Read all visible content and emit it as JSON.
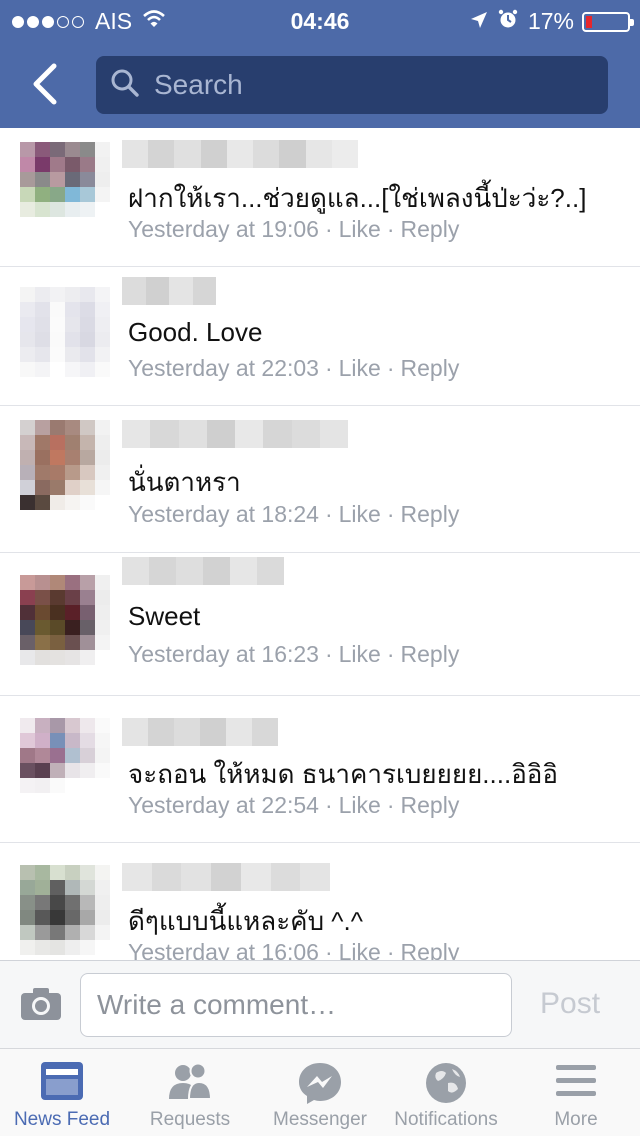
{
  "status_bar": {
    "carrier": "AIS",
    "time": "04:46",
    "battery_percent": "17%",
    "signal_bars_filled": 3,
    "signal_bars_total": 5
  },
  "header": {
    "search_placeholder": "Search"
  },
  "comments": [
    {
      "text": "ฝากให้เรา...ช่วยดูแล...[ใช่เพลงนี้ป่ะว่ะ?..]",
      "time": "Yesterday at 19:06",
      "like": "Like",
      "reply": "Reply"
    },
    {
      "text": "Good. Love",
      "time": "Yesterday at 22:03",
      "like": "Like",
      "reply": "Reply"
    },
    {
      "text": "นั่นตาหรา",
      "time": "Yesterday at 18:24",
      "like": "Like",
      "reply": "Reply"
    },
    {
      "text": "Sweet",
      "time": "Yesterday at 16:23",
      "like": "Like",
      "reply": "Reply"
    },
    {
      "text": "จะถอน ให้หมด ธนาคารเบยยยย....อิอิอิ",
      "time": "Yesterday at 22:54",
      "like": "Like",
      "reply": "Reply"
    },
    {
      "text": "ดีๆแบบนี้แหละคับ ^.^",
      "time": "Yesterday at 16:06",
      "like": "Like",
      "reply": "Reply"
    }
  ],
  "composer": {
    "placeholder": "Write a comment…",
    "post_label": "Post"
  },
  "tabbar": {
    "tabs": [
      {
        "label": "News Feed",
        "icon": "news-feed-icon",
        "active": true
      },
      {
        "label": "Requests",
        "icon": "requests-icon",
        "active": false
      },
      {
        "label": "Messenger",
        "icon": "messenger-icon",
        "active": false
      },
      {
        "label": "Notifications",
        "icon": "globe-icon",
        "active": false
      },
      {
        "label": "More",
        "icon": "menu-icon",
        "active": false
      }
    ]
  },
  "colors": {
    "header_blue": "#4d6aa8",
    "search_bg": "#283e6e",
    "active_tab": "#4b6bb3",
    "battery_low": "#e5262c"
  }
}
